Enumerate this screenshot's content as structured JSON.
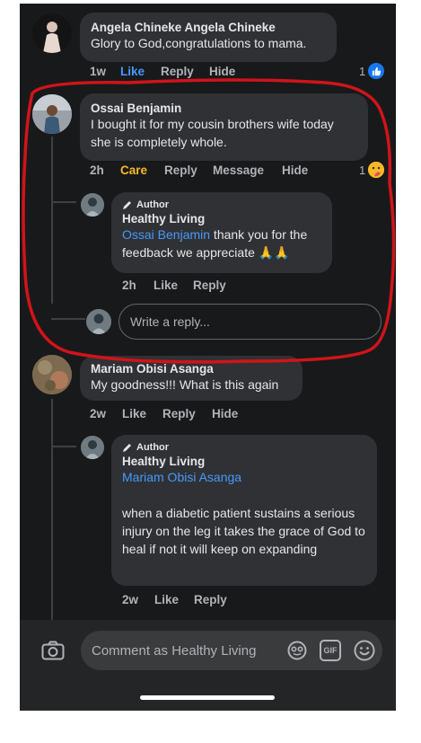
{
  "comments": [
    {
      "name": "Angela Chineke Angela Chineke",
      "text": "Glory to God,congratulations to mama.",
      "time": "1w",
      "actions": [
        "Like",
        "Reply",
        "Hide"
      ],
      "reaction_count": "1",
      "reaction": "like"
    },
    {
      "name": "Ossai Benjamin",
      "text": "I bought it for my cousin brothers wife today she is completely whole.",
      "time": "2h",
      "actions": [
        "Care",
        "Reply",
        "Message",
        "Hide"
      ],
      "reaction_count": "1",
      "reaction": "care",
      "reply": {
        "author_tag": "Author",
        "name": "Healthy Living",
        "mention": "Ossai Benjamin",
        "text": " thank you for the feedback we appreciate 🙏🙏",
        "time": "2h",
        "actions": [
          "Like",
          "Reply"
        ]
      },
      "reply_placeholder": "Write a reply..."
    },
    {
      "name": "Mariam Obisi Asanga",
      "text": "My goodness!!! What is this again",
      "time": "2w",
      "actions": [
        "Like",
        "Reply",
        "Hide"
      ],
      "reply": {
        "author_tag": "Author",
        "name": "Healthy Living",
        "mention": "Mariam Obisi Asanga",
        "text": "when a diabetic patient sustains a serious injury on the leg it takes the grace of God to heal if not it will keep on expanding",
        "time": "2w",
        "actions": [
          "Like",
          "Reply"
        ]
      }
    }
  ],
  "composer": {
    "placeholder": "Comment as Healthy Living",
    "gif_label": "GIF",
    "icons": [
      "camera-icon",
      "sticker-icon",
      "gif-icon",
      "emoji-icon"
    ]
  },
  "colors": {
    "background": "#18191a",
    "bubble": "#303134",
    "link": "#4599ff",
    "care": "#f7b928",
    "annotation": "#d0141a"
  }
}
